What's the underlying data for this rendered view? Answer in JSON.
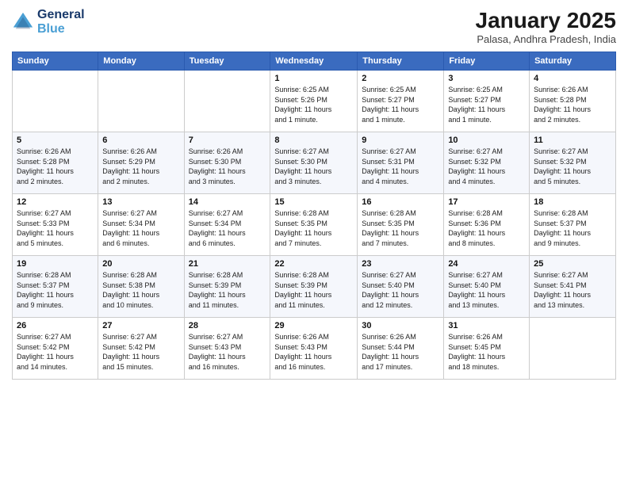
{
  "header": {
    "logo_line1": "General",
    "logo_line2": "Blue",
    "month": "January 2025",
    "location": "Palasa, Andhra Pradesh, India"
  },
  "weekdays": [
    "Sunday",
    "Monday",
    "Tuesday",
    "Wednesday",
    "Thursday",
    "Friday",
    "Saturday"
  ],
  "weeks": [
    [
      {
        "day": "",
        "info": ""
      },
      {
        "day": "",
        "info": ""
      },
      {
        "day": "",
        "info": ""
      },
      {
        "day": "1",
        "info": "Sunrise: 6:25 AM\nSunset: 5:26 PM\nDaylight: 11 hours\nand 1 minute."
      },
      {
        "day": "2",
        "info": "Sunrise: 6:25 AM\nSunset: 5:27 PM\nDaylight: 11 hours\nand 1 minute."
      },
      {
        "day": "3",
        "info": "Sunrise: 6:25 AM\nSunset: 5:27 PM\nDaylight: 11 hours\nand 1 minute."
      },
      {
        "day": "4",
        "info": "Sunrise: 6:26 AM\nSunset: 5:28 PM\nDaylight: 11 hours\nand 2 minutes."
      }
    ],
    [
      {
        "day": "5",
        "info": "Sunrise: 6:26 AM\nSunset: 5:28 PM\nDaylight: 11 hours\nand 2 minutes."
      },
      {
        "day": "6",
        "info": "Sunrise: 6:26 AM\nSunset: 5:29 PM\nDaylight: 11 hours\nand 2 minutes."
      },
      {
        "day": "7",
        "info": "Sunrise: 6:26 AM\nSunset: 5:30 PM\nDaylight: 11 hours\nand 3 minutes."
      },
      {
        "day": "8",
        "info": "Sunrise: 6:27 AM\nSunset: 5:30 PM\nDaylight: 11 hours\nand 3 minutes."
      },
      {
        "day": "9",
        "info": "Sunrise: 6:27 AM\nSunset: 5:31 PM\nDaylight: 11 hours\nand 4 minutes."
      },
      {
        "day": "10",
        "info": "Sunrise: 6:27 AM\nSunset: 5:32 PM\nDaylight: 11 hours\nand 4 minutes."
      },
      {
        "day": "11",
        "info": "Sunrise: 6:27 AM\nSunset: 5:32 PM\nDaylight: 11 hours\nand 5 minutes."
      }
    ],
    [
      {
        "day": "12",
        "info": "Sunrise: 6:27 AM\nSunset: 5:33 PM\nDaylight: 11 hours\nand 5 minutes."
      },
      {
        "day": "13",
        "info": "Sunrise: 6:27 AM\nSunset: 5:34 PM\nDaylight: 11 hours\nand 6 minutes."
      },
      {
        "day": "14",
        "info": "Sunrise: 6:27 AM\nSunset: 5:34 PM\nDaylight: 11 hours\nand 6 minutes."
      },
      {
        "day": "15",
        "info": "Sunrise: 6:28 AM\nSunset: 5:35 PM\nDaylight: 11 hours\nand 7 minutes."
      },
      {
        "day": "16",
        "info": "Sunrise: 6:28 AM\nSunset: 5:35 PM\nDaylight: 11 hours\nand 7 minutes."
      },
      {
        "day": "17",
        "info": "Sunrise: 6:28 AM\nSunset: 5:36 PM\nDaylight: 11 hours\nand 8 minutes."
      },
      {
        "day": "18",
        "info": "Sunrise: 6:28 AM\nSunset: 5:37 PM\nDaylight: 11 hours\nand 9 minutes."
      }
    ],
    [
      {
        "day": "19",
        "info": "Sunrise: 6:28 AM\nSunset: 5:37 PM\nDaylight: 11 hours\nand 9 minutes."
      },
      {
        "day": "20",
        "info": "Sunrise: 6:28 AM\nSunset: 5:38 PM\nDaylight: 11 hours\nand 10 minutes."
      },
      {
        "day": "21",
        "info": "Sunrise: 6:28 AM\nSunset: 5:39 PM\nDaylight: 11 hours\nand 11 minutes."
      },
      {
        "day": "22",
        "info": "Sunrise: 6:28 AM\nSunset: 5:39 PM\nDaylight: 11 hours\nand 11 minutes."
      },
      {
        "day": "23",
        "info": "Sunrise: 6:27 AM\nSunset: 5:40 PM\nDaylight: 11 hours\nand 12 minutes."
      },
      {
        "day": "24",
        "info": "Sunrise: 6:27 AM\nSunset: 5:40 PM\nDaylight: 11 hours\nand 13 minutes."
      },
      {
        "day": "25",
        "info": "Sunrise: 6:27 AM\nSunset: 5:41 PM\nDaylight: 11 hours\nand 13 minutes."
      }
    ],
    [
      {
        "day": "26",
        "info": "Sunrise: 6:27 AM\nSunset: 5:42 PM\nDaylight: 11 hours\nand 14 minutes."
      },
      {
        "day": "27",
        "info": "Sunrise: 6:27 AM\nSunset: 5:42 PM\nDaylight: 11 hours\nand 15 minutes."
      },
      {
        "day": "28",
        "info": "Sunrise: 6:27 AM\nSunset: 5:43 PM\nDaylight: 11 hours\nand 16 minutes."
      },
      {
        "day": "29",
        "info": "Sunrise: 6:26 AM\nSunset: 5:43 PM\nDaylight: 11 hours\nand 16 minutes."
      },
      {
        "day": "30",
        "info": "Sunrise: 6:26 AM\nSunset: 5:44 PM\nDaylight: 11 hours\nand 17 minutes."
      },
      {
        "day": "31",
        "info": "Sunrise: 6:26 AM\nSunset: 5:45 PM\nDaylight: 11 hours\nand 18 minutes."
      },
      {
        "day": "",
        "info": ""
      }
    ]
  ]
}
